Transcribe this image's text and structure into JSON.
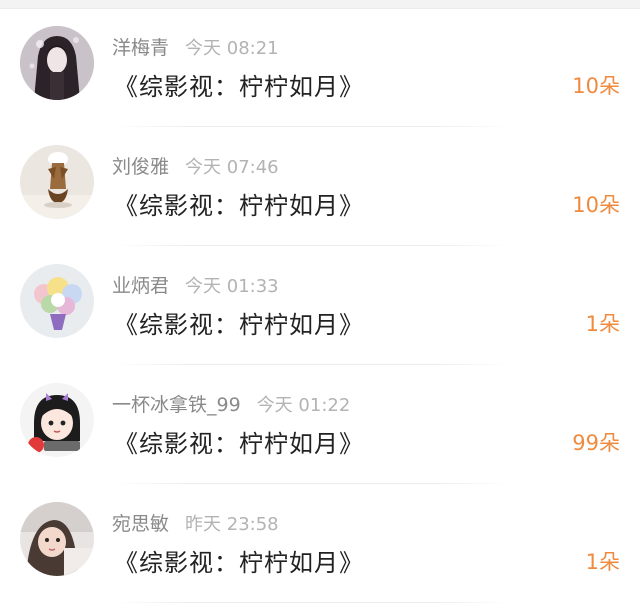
{
  "gift_list": [
    {
      "user": "洋梅青",
      "time": "今天 08:21",
      "book_title": "《综影视：柠柠如月》",
      "gift_count": "10朵"
    },
    {
      "user": "刘俊雅",
      "time": "今天 07:46",
      "book_title": "《综影视：柠柠如月》",
      "gift_count": "10朵"
    },
    {
      "user": "业炳君",
      "time": "今天 01:33",
      "book_title": "《综影视：柠柠如月》",
      "gift_count": "1朵"
    },
    {
      "user": "一杯冰拿铁_99",
      "time": "今天 01:22",
      "book_title": "《综影视：柠柠如月》",
      "gift_count": "99朵"
    },
    {
      "user": "宛思敏",
      "time": "昨天 23:58",
      "book_title": "《综影视：柠柠如月》",
      "gift_count": "1朵"
    }
  ],
  "colors": {
    "accent": "#f08a3e",
    "name_gray": "#8a8a8a",
    "time_gray": "#b3b3b3",
    "title_text": "#222222"
  }
}
